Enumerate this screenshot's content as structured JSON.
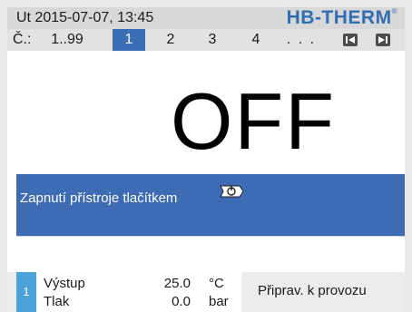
{
  "header": {
    "datetime": "Ut  2015-07-07, 13:45",
    "brand": "HB-THERM",
    "brand_mark": "®"
  },
  "nav": {
    "label": "Č.:",
    "range": "1..99",
    "tabs": [
      "1",
      "2",
      "3",
      "4"
    ],
    "selected_tab": "1",
    "ellipsis": ". . .",
    "prev_icon": "skip-back-icon",
    "next_icon": "skip-forward-icon"
  },
  "status": {
    "main": "OFF"
  },
  "info": {
    "message": "Zapnutí přístroje tlačítkem",
    "icon": "power-key-icon"
  },
  "bottom": {
    "unit_number": "1",
    "measurements": [
      {
        "label": "Výstup",
        "value": "25.0",
        "unit": "°C"
      },
      {
        "label": "Tlak",
        "value": "0.0",
        "unit": "bar"
      }
    ],
    "state": "Připrav. k provozu"
  },
  "colors": {
    "accent": "#3d6cb4",
    "brand": "#2f6db5",
    "unit_badge": "#4aa2da"
  }
}
